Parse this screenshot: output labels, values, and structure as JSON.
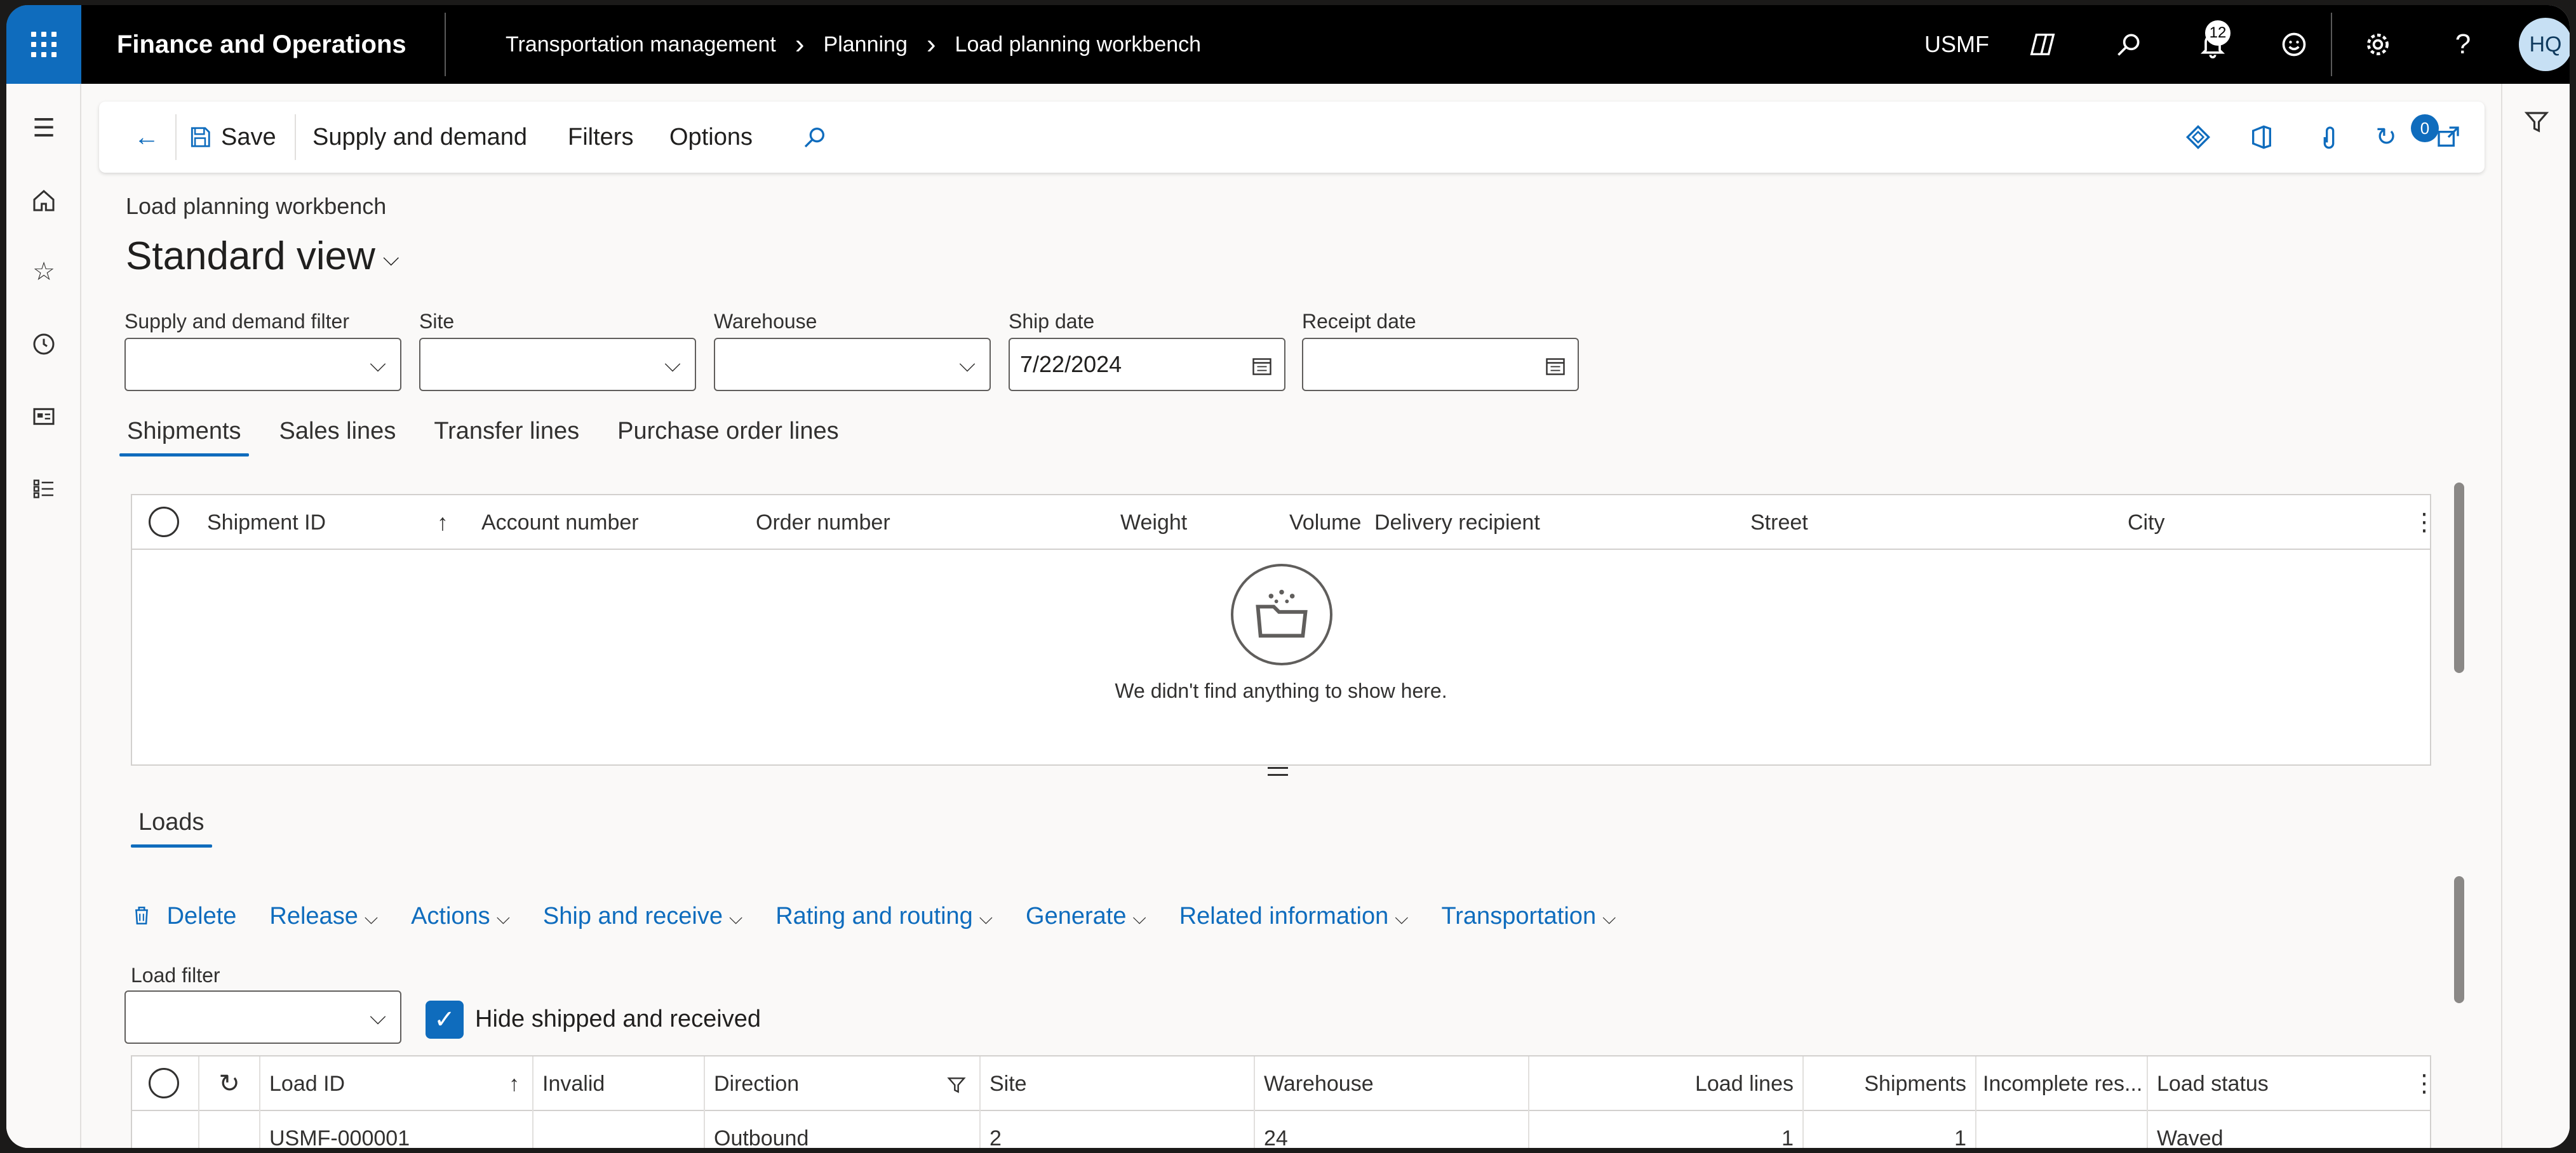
{
  "app": {
    "title": "Finance and Operations"
  },
  "breadcrumb": [
    "Transportation management",
    "Planning",
    "Load planning workbench"
  ],
  "topbar": {
    "company": "USMF",
    "notification_count": "12",
    "avatar_initials": "HQ"
  },
  "icons": {
    "waffle": "app-launcher-icon",
    "copilot": "copilot-icon",
    "search": "search-icon",
    "bell": "notification-bell-icon",
    "smiley": "feedback-icon",
    "gear": "settings-icon",
    "help": "help-icon",
    "filter": "filter-icon"
  },
  "actionpane": {
    "save_label": "Save",
    "items": [
      "Supply and demand",
      "Filters",
      "Options"
    ],
    "attachments_count": "0"
  },
  "page": {
    "caption": "Load planning workbench",
    "view_title": "Standard view"
  },
  "filters": {
    "supply_demand": {
      "label": "Supply and demand filter",
      "value": ""
    },
    "site": {
      "label": "Site",
      "value": ""
    },
    "warehouse": {
      "label": "Warehouse",
      "value": ""
    },
    "ship_date": {
      "label": "Ship date",
      "value": "7/22/2024"
    },
    "receipt_date": {
      "label": "Receipt date",
      "value": ""
    }
  },
  "tabs": [
    "Shipments",
    "Sales lines",
    "Transfer lines",
    "Purchase order lines"
  ],
  "shipments_grid": {
    "columns": [
      "Shipment ID",
      "Account number",
      "Order number",
      "Weight",
      "Volume",
      "Delivery recipient",
      "Street",
      "City"
    ],
    "empty_message": "We didn't find anything to show here."
  },
  "loads": {
    "tab_label": "Loads",
    "actions": [
      "Delete",
      "Release",
      "Actions",
      "Ship and receive",
      "Rating and routing",
      "Generate",
      "Related information",
      "Transportation"
    ],
    "load_filter_label": "Load filter",
    "load_filter_value": "",
    "hide_shipped_label": "Hide shipped and received",
    "hide_shipped_checked": true,
    "columns": [
      "Load ID",
      "Invalid",
      "Direction",
      "Site",
      "Warehouse",
      "Load lines",
      "Shipments",
      "Incomplete res...",
      "Load status"
    ],
    "rows": [
      {
        "load_id": "USMF-000001",
        "invalid": "",
        "direction": "Outbound",
        "site": "2",
        "warehouse": "24",
        "load_lines": "1",
        "shipments": "1",
        "incomplete": "",
        "status": "Waved"
      }
    ]
  },
  "colors": {
    "accent": "#0f6cbd",
    "topbar": "#000000",
    "background": "#faf9f8"
  }
}
